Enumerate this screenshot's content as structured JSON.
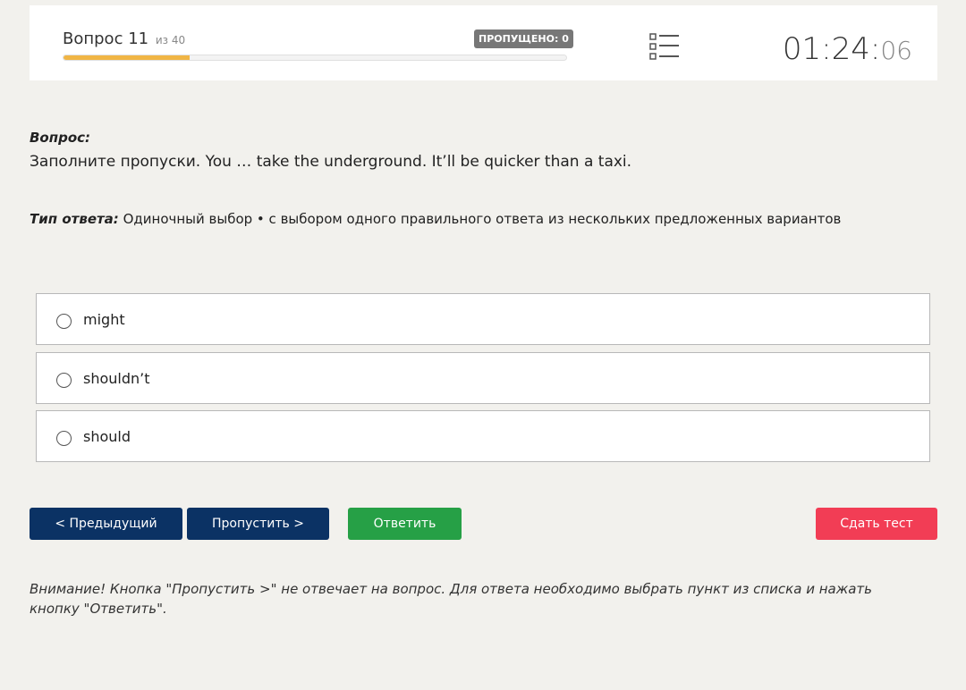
{
  "header": {
    "question_word": "Вопрос",
    "question_number": "11",
    "question_of": "из 40",
    "progress_fraction": 0.25,
    "skipped_label": "ПРОПУЩЕНО: 0",
    "list_icon": "question-list-icon",
    "timer_main": "01:24:",
    "timer_seconds": "06"
  },
  "question": {
    "label": "Вопрос:",
    "text": "Заполните пропуски. You … take the underground. It’ll be quicker than a taxi.",
    "answer_type_label": "Тип ответа:",
    "answer_type_value": "Одиночный выбор • с выбором одного правильного ответа из нескольких предложенных вариантов"
  },
  "options": [
    {
      "text": "might",
      "selected": false
    },
    {
      "text": "shouldn’t",
      "selected": false
    },
    {
      "text": "should",
      "selected": false
    }
  ],
  "buttons": {
    "prev": "< Предыдущий",
    "skip": "Пропустить >",
    "answer": "Ответить",
    "submit": "Сдать тест"
  },
  "notice": "Внимание! Кнопка \"Пропустить >\" не отвечает на вопрос. Для ответа необходимо выбрать пункт из списка и нажать кнопку \"Ответить\".",
  "colors": {
    "background": "#f2f1ed",
    "progress": "#f0b545",
    "primary_button": "#0b3264",
    "answer_button": "#26a046",
    "submit_button": "#f23d55",
    "badge": "#777777"
  }
}
